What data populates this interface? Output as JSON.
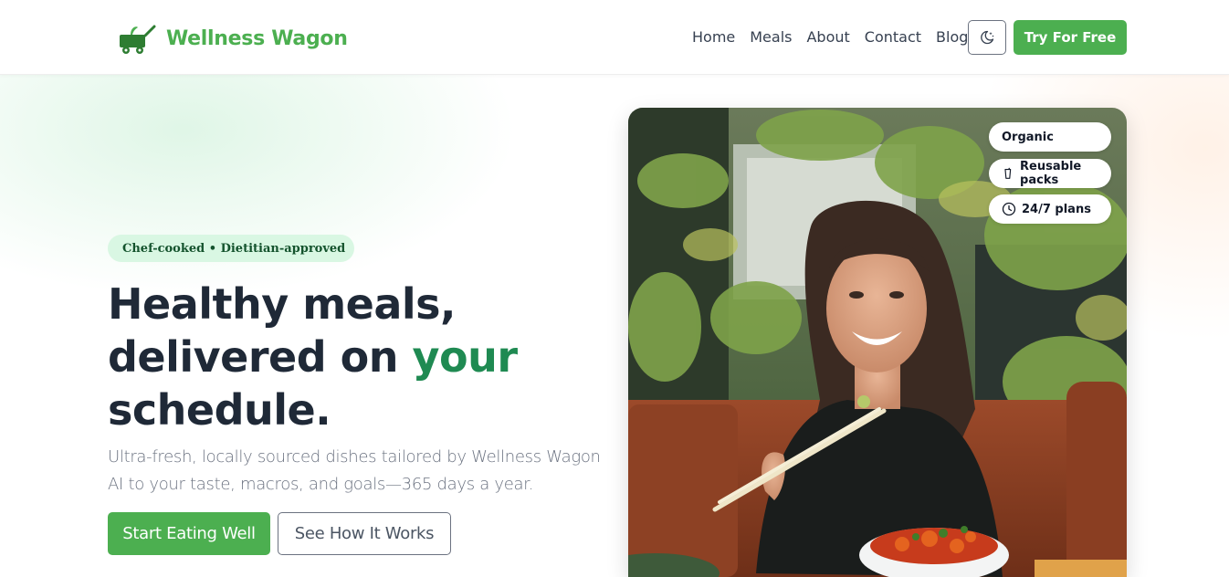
{
  "brand": {
    "name": "Wellness Wagon",
    "color": "#4caf50"
  },
  "nav": {
    "items": [
      {
        "label": "Home"
      },
      {
        "label": "Meals"
      },
      {
        "label": "About"
      },
      {
        "label": "Contact"
      },
      {
        "label": "Blog"
      }
    ],
    "theme_toggle_icon": "moon-stars-icon",
    "cta_label": "Try For Free"
  },
  "hero": {
    "chip": "Chef-cooked • Dietitian-approved",
    "headline_part1": "Healthy meals,",
    "headline_part2": "delivered on ",
    "headline_accent": "your",
    "headline_part3": "schedule.",
    "subtitle": "Ultra-fresh, locally sourced dishes tailored by Wellness Wagon AI to your taste, macros, and goals—365 days a year.",
    "primary_cta": "Start Eating Well",
    "secondary_cta": "See How It Works",
    "accent_color": "#1f8a52"
  },
  "badges": [
    {
      "label": "Organic",
      "icon": ""
    },
    {
      "label": "Reusable packs",
      "icon": "cup-icon"
    },
    {
      "label": "24/7 plans",
      "icon": "clock-icon"
    }
  ]
}
